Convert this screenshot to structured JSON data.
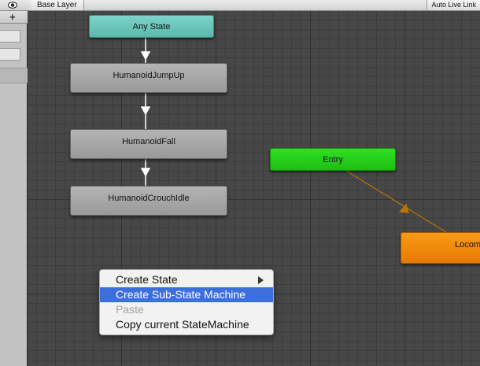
{
  "header": {
    "breadcrumb": "Base Layer",
    "live_link": "Auto Live Link"
  },
  "graph": {
    "nodes": {
      "any_state": "Any State",
      "jump_up": "HumanoidJumpUp",
      "fall": "HumanoidFall",
      "crouch_idle": "HumanoidCrouchIdle",
      "entry": "Entry",
      "locomotion": "Locom"
    }
  },
  "context_menu": {
    "items": [
      {
        "label": "Create State"
      },
      {
        "label": "Create Sub-State Machine"
      },
      {
        "label": "Paste"
      },
      {
        "label": "Copy current StateMachine"
      }
    ]
  },
  "colors": {
    "any_state": "#6fc7bc",
    "entry": "#26d11a",
    "locomotion": "#f08a0a",
    "state": "#a8a8a8",
    "menu_highlight": "#3d6fdc"
  }
}
